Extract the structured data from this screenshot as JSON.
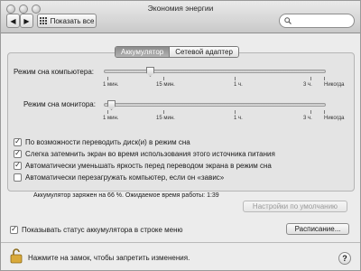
{
  "window": {
    "title": "Экономия энергии"
  },
  "toolbar": {
    "show_all_label": "Показать все",
    "search_placeholder": ""
  },
  "tabs": [
    {
      "label": "Аккумулятор",
      "active": true
    },
    {
      "label": "Сетевой адаптер",
      "active": false
    }
  ],
  "sliders": {
    "tick_labels": [
      "1 мин.",
      "15 мин.",
      "1 ч.",
      "3 ч.",
      "Никогда"
    ],
    "computer_sleep": {
      "label": "Режим сна компьютера:",
      "value": "15 мин."
    },
    "display_sleep": {
      "label": "Режим сна монитора:",
      "value": "1 мин."
    }
  },
  "options": [
    {
      "label": "По возможности переводить диск(и) в режим сна",
      "checked": true
    },
    {
      "label": "Слегка затемнить экран во время использования этого источника питания",
      "checked": true
    },
    {
      "label": "Автоматически уменьшать яркость перед переводом экрана в режим сна",
      "checked": true
    },
    {
      "label": "Автоматически перезагружать компьютер, если он «завис»",
      "checked": false
    }
  ],
  "battery_status": "Аккумулятор заряжен на 66 %. Ожидаемое время работы: 1:39",
  "defaults_button": "Настройки по умолчанию",
  "show_battery_status": {
    "label": "Показывать статус аккумулятора в строке меню",
    "checked": true
  },
  "schedule_button": "Расписание...",
  "lock_text": "Нажмите на замок, чтобы запретить изменения.",
  "help_label": "?"
}
